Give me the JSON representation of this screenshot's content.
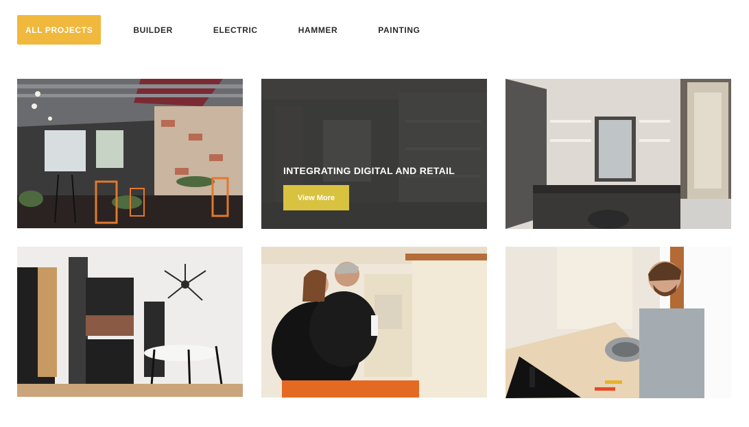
{
  "filters": {
    "items": [
      {
        "label": "ALL PROJECTS",
        "active": true
      },
      {
        "label": "BUILDER",
        "active": false
      },
      {
        "label": "ELECTRIC",
        "active": false
      },
      {
        "label": "HAMMER",
        "active": false
      },
      {
        "label": "PAINTING",
        "active": false
      }
    ],
    "active_color": "#f0b83c"
  },
  "projects": [
    {
      "image": "industrial-cafe-interior"
    },
    {
      "image": "office-shelving-interior",
      "title": "INTEGRATING DIGITAL AND RETAIL",
      "button_label": "View More"
    },
    {
      "image": "window-desk-room"
    },
    {
      "image": "kitchen-dining-room"
    },
    {
      "image": "plumbers-under-sink"
    },
    {
      "image": "man-fixing-kitchen-sink"
    }
  ],
  "colors": {
    "view_more_button": "#d9c23f",
    "overlay": "#282828"
  }
}
